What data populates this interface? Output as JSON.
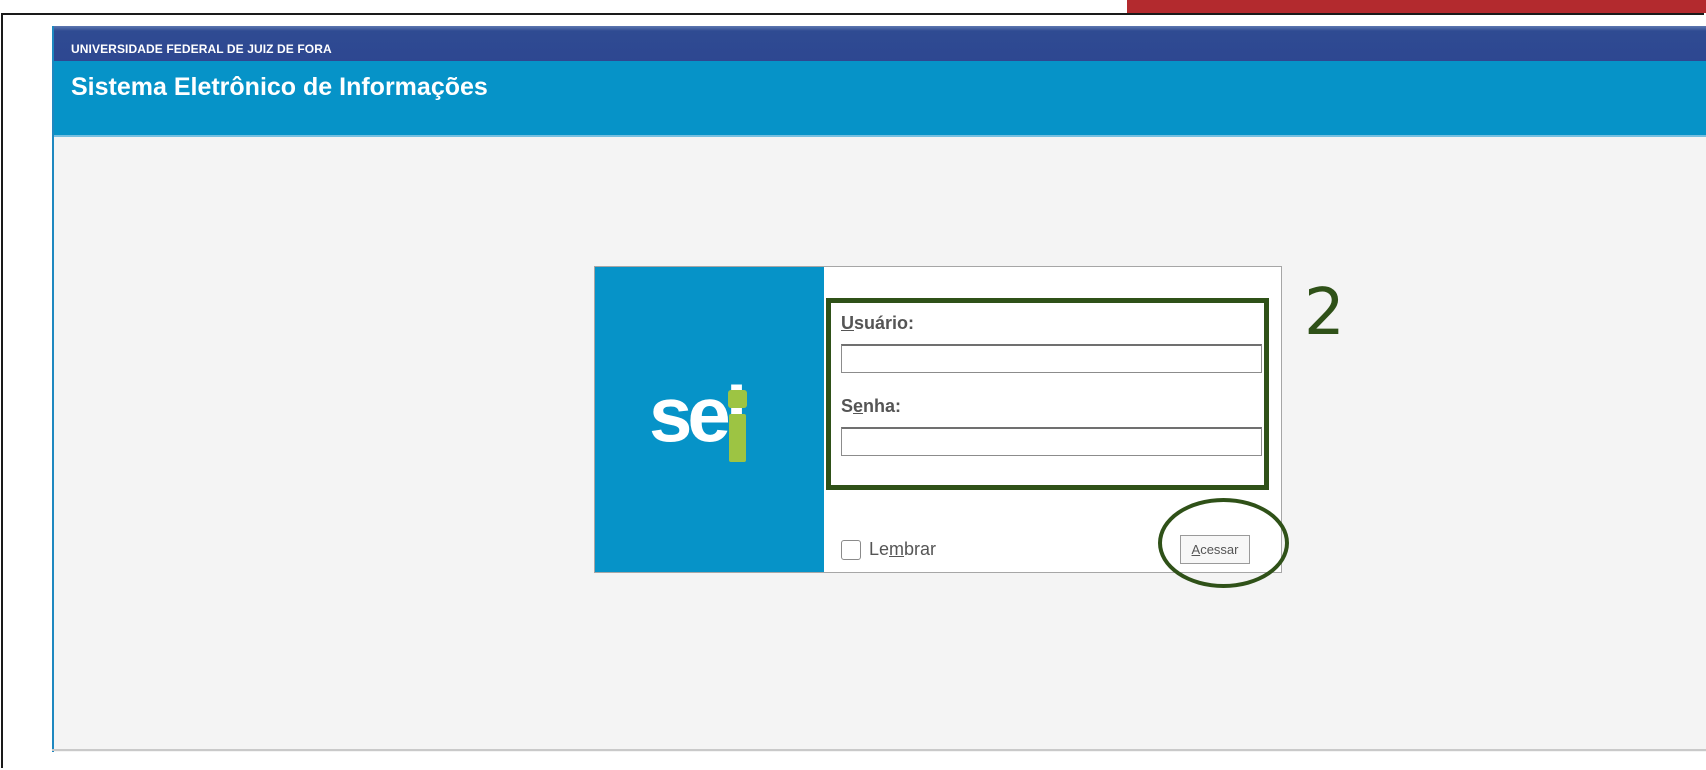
{
  "header": {
    "institution": "UNIVERSIDADE FEDERAL DE JUIZ DE FORA",
    "system_title": "Sistema Eletrônico de Informações"
  },
  "logo": {
    "text": "sei",
    "icon": "sei-exclamation-logo",
    "text_color": "#ffffff",
    "accent_color": "#9dc443",
    "panel_color": "#0693c8"
  },
  "login": {
    "user_label_key": "U",
    "user_label_rest": "suário:",
    "user_value": "",
    "password_label_first": "S",
    "password_label_key": "e",
    "password_label_rest": "nha:",
    "password_value": "",
    "remember_label_first": "Le",
    "remember_label_key": "m",
    "remember_label_rest": "brar",
    "remember_checked": false,
    "submit_key": "A",
    "submit_rest": "cessar"
  },
  "annotation": {
    "step_number": "2",
    "color": "#2f5118"
  },
  "colors": {
    "top_band": "#2e4791",
    "title_band": "#0693c8",
    "content_background": "#f4f4f4",
    "slide_accent": "#b32a2e"
  }
}
